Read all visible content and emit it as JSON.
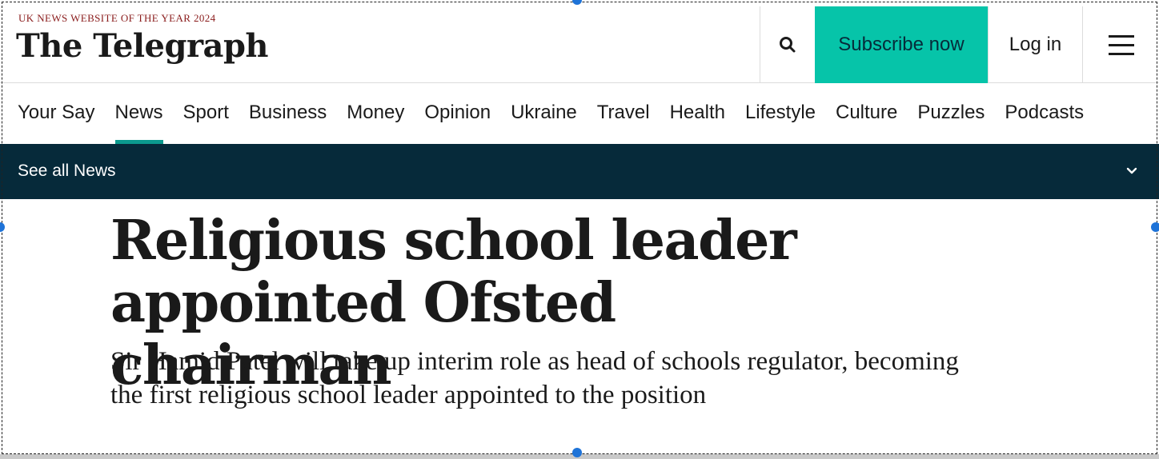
{
  "masthead": {
    "tagline": "UK NEWS WEBSITE OF THE YEAR 2024",
    "logo_text": "The Telegraph",
    "search_icon": "search-icon",
    "subscribe_label": "Subscribe now",
    "login_label": "Log in",
    "menu_icon": "hamburger-menu-icon"
  },
  "nav": {
    "items": [
      {
        "label": "Your Say"
      },
      {
        "label": "News",
        "active": true
      },
      {
        "label": "Sport"
      },
      {
        "label": "Business"
      },
      {
        "label": "Money"
      },
      {
        "label": "Opinion"
      },
      {
        "label": "Ukraine"
      },
      {
        "label": "Travel"
      },
      {
        "label": "Health"
      },
      {
        "label": "Lifestyle"
      },
      {
        "label": "Culture"
      },
      {
        "label": "Puzzles"
      },
      {
        "label": "Podcasts"
      }
    ]
  },
  "subnav": {
    "label": "See all News",
    "icon": "chevron-down-icon"
  },
  "article": {
    "headline": "Religious school leader appointed Ofsted chairman",
    "standfirst": "Sir Hamid Patel will take up interim role as head of schools regulator, becoming the first religious school leader appointed to the position"
  },
  "colors": {
    "subscribe_bg": "#06c4a9",
    "subnav_bg": "#062a3a",
    "active_underline": "#0b9a8e",
    "tagline": "#8a1c1c"
  }
}
